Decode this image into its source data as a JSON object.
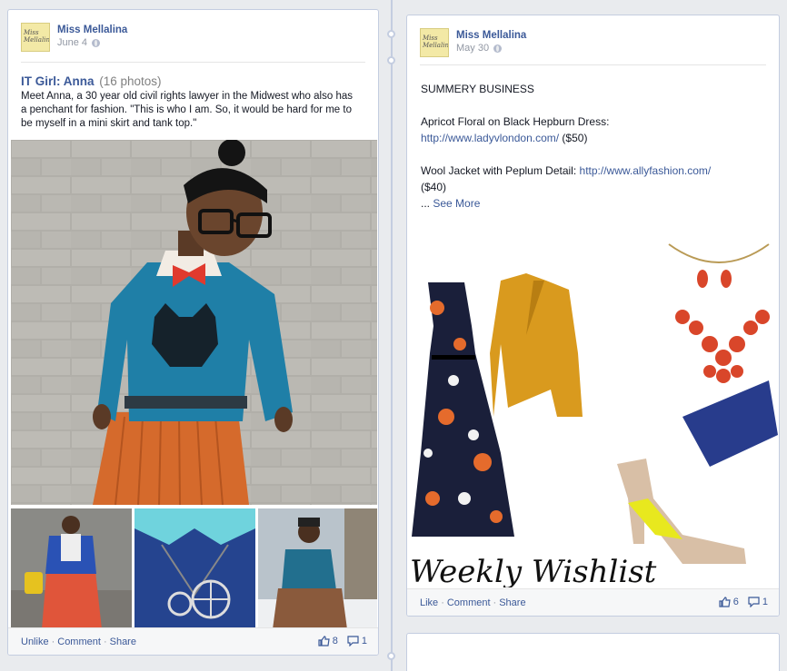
{
  "left_post": {
    "author": "Miss Mellalina",
    "avatar_text": "Miss Mellalina",
    "date": "June 4",
    "album_title": "IT Girl: Anna",
    "album_count": "(16 photos)",
    "description": "Meet Anna, a 30 year old civil rights lawyer in the Midwest who also has a penchant for fashion. \"This is who I am. So, it would be hard for me to be myself in a mini skirt and tank top.\"",
    "actions": {
      "unlike": "Unlike",
      "comment": "Comment",
      "share": "Share",
      "separator": "·"
    },
    "like_count": "8",
    "comment_count": "1"
  },
  "right_post": {
    "author": "Miss Mellalina",
    "avatar_text": "Miss Mellalina",
    "date": "May 30",
    "heading": "SUMMERY BUSINESS",
    "item1_text": "Apricot Floral on Black Hepburn Dress:",
    "item1_link": "http://www.ladyvlondon.com/",
    "item1_price": "($50)",
    "item2_text": "Wool Jacket with Peplum Detail:",
    "item2_link": "http://www.allyfashion.com/",
    "item2_price": "($40)",
    "ellipsis": "...",
    "see_more": "See More",
    "image_caption": "Weekly Wishlist",
    "actions": {
      "like": "Like",
      "comment": "Comment",
      "share": "Share",
      "separator": "·"
    },
    "like_count": "6",
    "comment_count": "1"
  },
  "colors": {
    "link": "#3b5998",
    "background": "#e9ebee",
    "meta": "#9197a3"
  },
  "icons": [
    "globe-icon",
    "thumbs-up-icon",
    "comment-icon"
  ]
}
